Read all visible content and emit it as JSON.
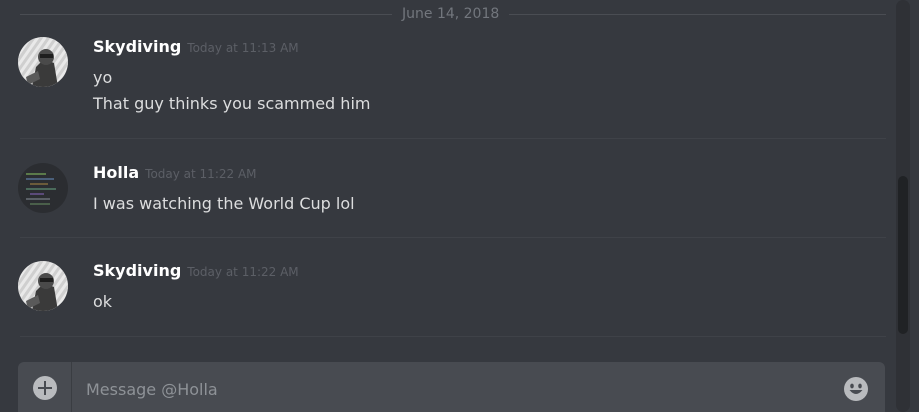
{
  "date_divider": "June 14, 2018",
  "messages": [
    {
      "author": "Skydiving",
      "timestamp": "Today at 11:13 AM",
      "lines": [
        "yo",
        "That guy thinks you scammed him"
      ],
      "avatar_icon": "skydiving-avatar"
    },
    {
      "author": "Holla",
      "timestamp": "Today at 11:22 AM",
      "lines": [
        "I was watching the World Cup lol"
      ],
      "avatar_icon": "holla-avatar"
    },
    {
      "author": "Skydiving",
      "timestamp": "Today at 11:22 AM",
      "lines": [
        "ok"
      ],
      "avatar_icon": "skydiving-avatar"
    }
  ],
  "composer": {
    "placeholder": "Message @Holla",
    "attach_icon": "plus-circle-icon",
    "emoji_icon": "smiley-emoji-icon"
  },
  "colors": {
    "background": "#36393f",
    "username": "#ffffff",
    "message_text": "#dcddde",
    "timestamp": "#72767d",
    "input_bg": "#484b51"
  }
}
